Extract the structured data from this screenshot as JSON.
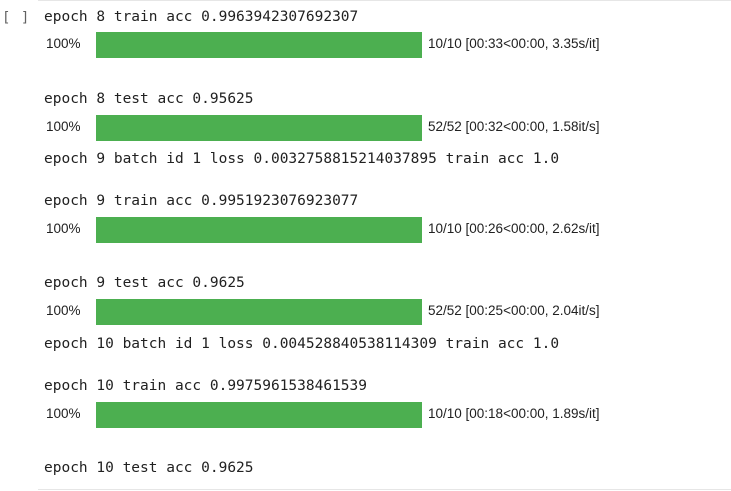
{
  "cell": {
    "run_indicator": "[ ]"
  },
  "lines": [
    {
      "text": "epoch 8 train acc 0.9963942307692307"
    },
    {
      "text": "epoch 8 test acc 0.95625"
    },
    {
      "text": "epoch 9 batch id 1 loss 0.0032758815214037895 train acc 1.0"
    },
    {
      "text": "epoch 9 train acc 0.9951923076923077"
    },
    {
      "text": "epoch 9 test acc 0.9625"
    },
    {
      "text": "epoch 10 batch id 1 loss 0.004528840538114309 train acc 1.0"
    },
    {
      "text": "epoch 10 train acc 0.9975961538461539"
    },
    {
      "text": "epoch 10 test acc 0.9625"
    }
  ],
  "progress_bars": [
    {
      "percent_label": "100%",
      "fraction": 1.0,
      "stats": "10/10 [00:33<00:00, 3.35s/it]"
    },
    {
      "percent_label": "100%",
      "fraction": 1.0,
      "stats": "52/52 [00:32<00:00, 1.58it/s]"
    },
    {
      "percent_label": "100%",
      "fraction": 1.0,
      "stats": "10/10 [00:26<00:00, 2.62s/it]"
    },
    {
      "percent_label": "100%",
      "fraction": 1.0,
      "stats": "52/52 [00:25<00:00, 2.04it/s]"
    },
    {
      "percent_label": "100%",
      "fraction": 1.0,
      "stats": "10/10 [00:18<00:00, 1.89s/it]"
    }
  ],
  "colors": {
    "bar_fill": "#4caf50",
    "bar_track": "#eeeeee"
  }
}
